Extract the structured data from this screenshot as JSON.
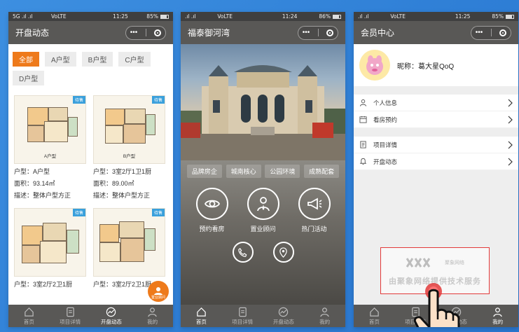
{
  "status": {
    "p1": {
      "signal": "5G .ıl .ıl",
      "carrier": "VoLTE",
      "time": "11:25",
      "right": "85%"
    },
    "p2": {
      "signal": ".ıl .ıl",
      "carrier": "VoLTE",
      "time": "11:24",
      "right": "86%"
    },
    "p3": {
      "signal": ".ıl .ıl",
      "carrier": "VoLTE",
      "time": "11:25",
      "right": "85%"
    }
  },
  "capsule": {
    "dots": "•••"
  },
  "screen1": {
    "title": "开盘动态",
    "filters": [
      "全部",
      "A户型",
      "B户型",
      "C户型",
      "D户型"
    ],
    "cards": [
      {
        "tag": "待售",
        "caption": "A户型",
        "type": "户型：A户型",
        "area": "面积：93.14㎡",
        "desc": "描述：整体户型方正"
      },
      {
        "tag": "待售",
        "caption": "B户型",
        "type": "户型：3室2厅1卫1厨",
        "area": "面积：89.00㎡",
        "desc": "描述：整体户型方正"
      },
      {
        "tag": "待售",
        "caption": "",
        "type": "户型：3室2厅2卫1厨",
        "area": "",
        "desc": ""
      },
      {
        "tag": "待售",
        "caption": "",
        "type": "户型：3室2厅2卫1厨",
        "area": "",
        "desc": ""
      }
    ],
    "float_label": "置业顾问",
    "tabs": [
      "首页",
      "项目详情",
      "开盘动态",
      "我的"
    ]
  },
  "screen2": {
    "title": "福泰御河湾",
    "categories": [
      "品牌房企",
      "城南核心",
      "公园环境",
      "成熟配套"
    ],
    "features": [
      "预约看房",
      "置业顾问",
      "热门活动"
    ],
    "tabs": [
      "首页",
      "项目详情",
      "开盘动态",
      "我的"
    ]
  },
  "screen3": {
    "title": "会员中心",
    "nickname": "昵称：葛大星QoQ",
    "menu1": [
      "个人信息",
      "看房预约"
    ],
    "menu2": [
      "项目详情",
      "开盘动态"
    ],
    "brand_name": "聚象网络",
    "brand_text": "由聚象网络提供技术服务",
    "tabs": [
      "首页",
      "项目详情",
      "开盘动态",
      "我的"
    ]
  },
  "colors": {
    "accent": "#ee7a1b",
    "nav": "#595856",
    "status": "#3f3f3f",
    "background": "#2f7fd6",
    "highlight_box": "#e23a3a"
  },
  "icons": [
    "home-icon",
    "document-icon",
    "trend-icon",
    "user-icon",
    "eye-icon",
    "advisor-icon",
    "megaphone-icon",
    "phone-icon",
    "location-icon",
    "chevron-right-icon",
    "calendar-icon",
    "bell-icon"
  ]
}
